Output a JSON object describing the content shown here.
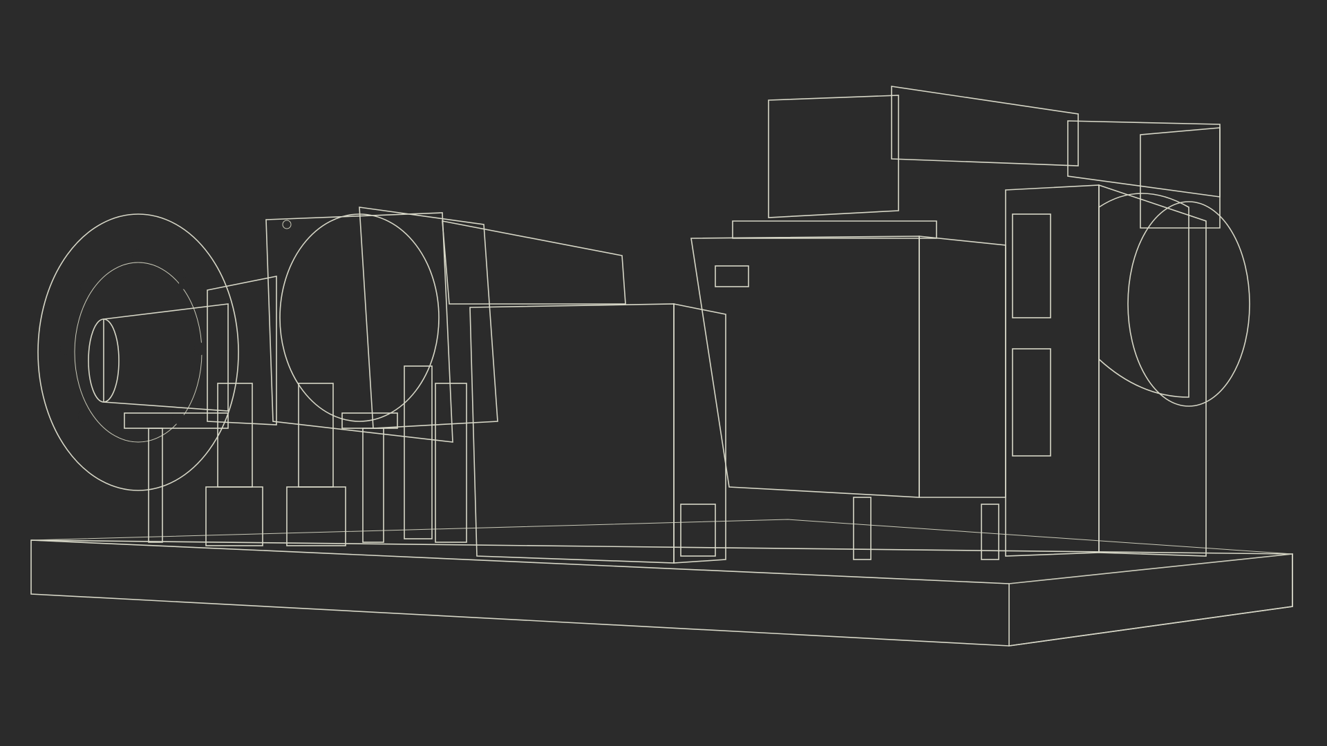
{
  "scene": {
    "subject": "wireframe-industrial-turbine-generator",
    "background_color": "#2b2b2b",
    "mesh_color": "#6e6e64",
    "wire_color": "#d8d8c8"
  }
}
